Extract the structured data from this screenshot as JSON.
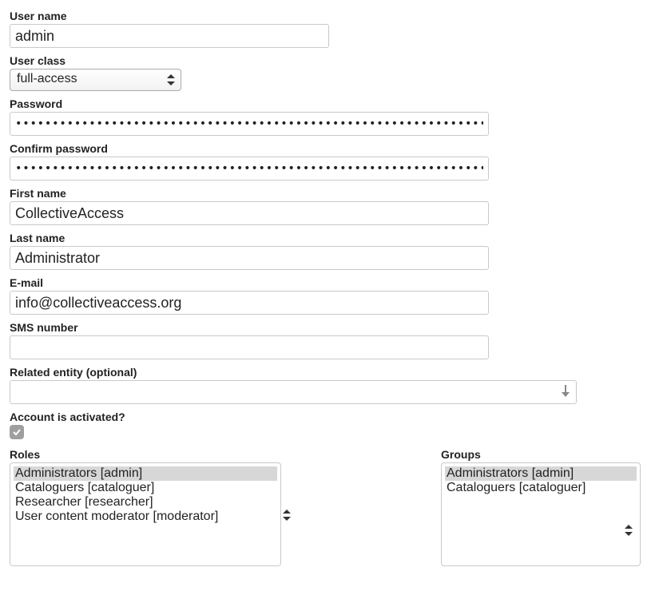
{
  "fields": {
    "username": {
      "label": "User name",
      "value": "admin"
    },
    "userclass": {
      "label": "User class",
      "value": "full-access"
    },
    "password": {
      "label": "Password",
      "value": "••••••••••••••••••••••••••••••••••••••••••••••••••••••••••••••••"
    },
    "confirm_password": {
      "label": "Confirm password",
      "value": "••••••••••••••••••••••••••••••••••••••••••••••••••••••••••••••••"
    },
    "first_name": {
      "label": "First name",
      "value": "CollectiveAccess"
    },
    "last_name": {
      "label": "Last name",
      "value": "Administrator"
    },
    "email": {
      "label": "E-mail",
      "value": "info@collectiveaccess.org"
    },
    "sms": {
      "label": "SMS number",
      "value": ""
    },
    "related_entity": {
      "label": "Related entity (optional)",
      "value": ""
    },
    "activated": {
      "label": "Account is activated?",
      "checked": true
    }
  },
  "roles": {
    "label": "Roles",
    "items": [
      {
        "label": "Administrators [admin]",
        "selected": true
      },
      {
        "label": "Cataloguers [cataloguer]",
        "selected": false
      },
      {
        "label": "Researcher [researcher]",
        "selected": false
      },
      {
        "label": "User content moderator [moderator]",
        "selected": false
      }
    ]
  },
  "groups": {
    "label": "Groups",
    "items": [
      {
        "label": "Administrators [admin]",
        "selected": true
      },
      {
        "label": "Cataloguers [cataloguer]",
        "selected": false
      }
    ]
  }
}
